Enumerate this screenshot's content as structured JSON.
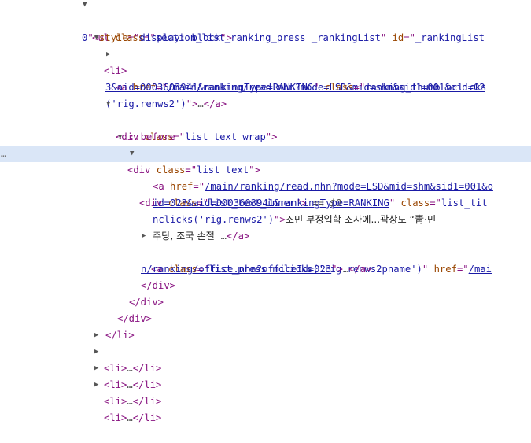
{
  "lines": [
    {
      "k": "1",
      "parts": [
        [
          "t",
          "<ul "
        ],
        [
          "an",
          "class"
        ],
        [
          "t",
          "=\""
        ],
        [
          "av",
          "section_list_ranking_press _rankingList"
        ],
        [
          "t",
          "\" "
        ],
        [
          "an",
          "id"
        ],
        [
          "t",
          "=\""
        ],
        [
          "av",
          "_rankingList"
        ]
      ]
    },
    {
      "k": "2",
      "parts": [
        [
          "av",
          "0"
        ],
        [
          "t",
          "\" "
        ],
        [
          "an",
          "style"
        ],
        [
          "t",
          "=\""
        ],
        [
          "av",
          "display: block"
        ],
        [
          "t",
          "\">"
        ]
      ]
    },
    {
      "k": "3",
      "parts": [
        [
          "t",
          "<li>"
        ]
      ]
    },
    {
      "k": "4",
      "parts": [
        [
          "t",
          "<a "
        ],
        [
          "an",
          "href"
        ],
        [
          "t",
          "=\""
        ],
        [
          "lk",
          "/main/ranking/read.nhn?mode=LSD&mid=shm&sid1=001&oid=02"
        ]
      ]
    },
    {
      "k": "5",
      "parts": [
        [
          "lk",
          "3&aid=0003603941&rankingType=RANKING"
        ],
        [
          "t",
          "\" "
        ],
        [
          "an",
          "class"
        ],
        [
          "t",
          "=\""
        ],
        [
          "av",
          "ranking_thumb nclicks"
        ]
      ]
    },
    {
      "k": "6",
      "parts": [
        [
          "av",
          "('rig.renws2')"
        ],
        [
          "t",
          "\">"
        ],
        [
          "dm",
          "…"
        ],
        [
          "t",
          "</a>"
        ]
      ]
    },
    {
      "k": "7",
      "parts": [
        [
          "t",
          "<div "
        ],
        [
          "an",
          "class"
        ],
        [
          "t",
          "=\""
        ],
        [
          "av",
          "list_text_wrap"
        ],
        [
          "t",
          "\">"
        ]
      ]
    },
    {
      "k": "8",
      "parts": [
        [
          "ps",
          "::before"
        ]
      ]
    },
    {
      "k": "9",
      "parts": [
        [
          "t",
          "<div "
        ],
        [
          "an",
          "class"
        ],
        [
          "t",
          "=\""
        ],
        [
          "av",
          "list_text"
        ],
        [
          "t",
          "\">"
        ]
      ]
    },
    {
      "k": "10",
      "parts": [
        [
          "t",
          "<div "
        ],
        [
          "an",
          "class"
        ],
        [
          "t",
          "=\""
        ],
        [
          "av",
          "list_text_inner"
        ],
        [
          "t",
          "\">"
        ],
        [
          "dm",
          " == "
        ],
        [
          "cv",
          "$0"
        ]
      ]
    },
    {
      "k": "11",
      "parts": [
        [
          "t",
          "<a "
        ],
        [
          "an",
          "href"
        ],
        [
          "t",
          "=\""
        ],
        [
          "lk",
          "/main/ranking/read.nhn?mode=LSD&mid=shm&sid1=001&o"
        ]
      ]
    },
    {
      "k": "12",
      "parts": [
        [
          "lk",
          "id=023&aid=0003603941&rankingType=RANKING"
        ],
        [
          "t",
          "\" "
        ],
        [
          "an",
          "class"
        ],
        [
          "t",
          "=\""
        ],
        [
          "av",
          "list_tit"
        ]
      ]
    },
    {
      "k": "13",
      "parts": [
        [
          "av",
          "nclicks('rig.renws2')"
        ],
        [
          "t",
          "\">"
        ],
        [
          "tx",
          "조민 부정입학 조사에...곽상도 “靑·민"
        ]
      ]
    },
    {
      "k": "14",
      "parts": [
        [
          "tx",
          "주당, 조국 손절  "
        ],
        [
          "dm",
          "…"
        ],
        [
          "t",
          "</a>"
        ]
      ]
    },
    {
      "k": "15",
      "parts": [
        [
          "t",
          "<a "
        ],
        [
          "an",
          "class"
        ],
        [
          "t",
          "=\""
        ],
        [
          "av",
          "list_press nclicks('rig.renws2pname')"
        ],
        [
          "t",
          "\" "
        ],
        [
          "an",
          "href"
        ],
        [
          "t",
          "=\""
        ],
        [
          "lk",
          "/mai"
        ]
      ]
    },
    {
      "k": "16",
      "parts": [
        [
          "lk",
          "n/ranking/office.nhn?officeId=023"
        ],
        [
          "t",
          "\">"
        ],
        [
          "dm",
          "…"
        ],
        [
          "t",
          "</a>"
        ]
      ]
    },
    {
      "k": "17",
      "parts": [
        [
          "t",
          "</div>"
        ]
      ]
    },
    {
      "k": "18",
      "parts": [
        [
          "t",
          "</div>"
        ]
      ]
    },
    {
      "k": "19",
      "parts": [
        [
          "t",
          "</div>"
        ]
      ]
    },
    {
      "k": "20",
      "parts": [
        [
          "t",
          "</li>"
        ]
      ]
    },
    {
      "k": "21",
      "parts": [
        [
          "t",
          "<li>"
        ],
        [
          "dm",
          "…"
        ],
        [
          "t",
          "</li>"
        ]
      ]
    },
    {
      "k": "22",
      "parts": [
        [
          "t",
          "<li>"
        ],
        [
          "dm",
          "…"
        ],
        [
          "t",
          "</li>"
        ]
      ]
    },
    {
      "k": "23",
      "parts": [
        [
          "t",
          "<li>"
        ],
        [
          "dm",
          "…"
        ],
        [
          "t",
          "</li>"
        ]
      ]
    },
    {
      "k": "24",
      "parts": [
        [
          "t",
          "<li>"
        ],
        [
          "dm",
          "…"
        ],
        [
          "t",
          "</li>"
        ]
      ]
    }
  ],
  "gutter_dots": "…"
}
